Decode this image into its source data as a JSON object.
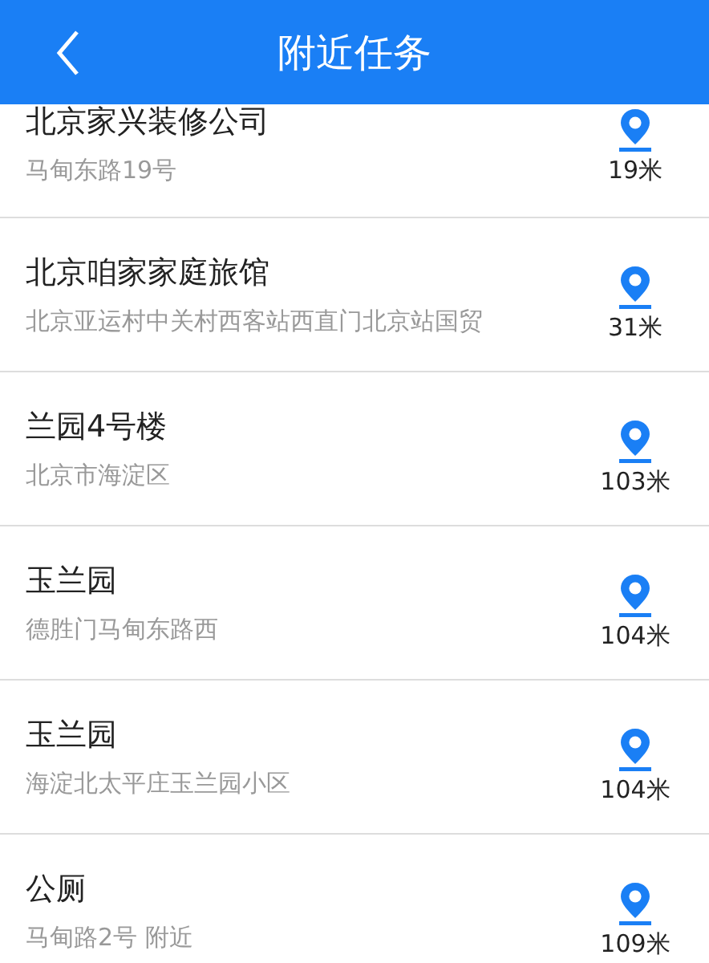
{
  "header": {
    "title": "附近任务"
  },
  "places": [
    {
      "name": "北京家兴装修公司",
      "address": "马甸东路19号",
      "distance": "19米"
    },
    {
      "name": "北京咱家家庭旅馆",
      "address": "北京亚运村中关村西客站西直门北京站国贸",
      "distance": "31米"
    },
    {
      "name": "兰园4号楼",
      "address": "北京市海淀区",
      "distance": "103米"
    },
    {
      "name": "玉兰园",
      "address": "德胜门马甸东路西",
      "distance": "104米"
    },
    {
      "name": "玉兰园",
      "address": "海淀北太平庄玉兰园小区",
      "distance": "104米"
    },
    {
      "name": "公厕",
      "address": "马甸路2号 附近",
      "distance": "109米"
    }
  ]
}
